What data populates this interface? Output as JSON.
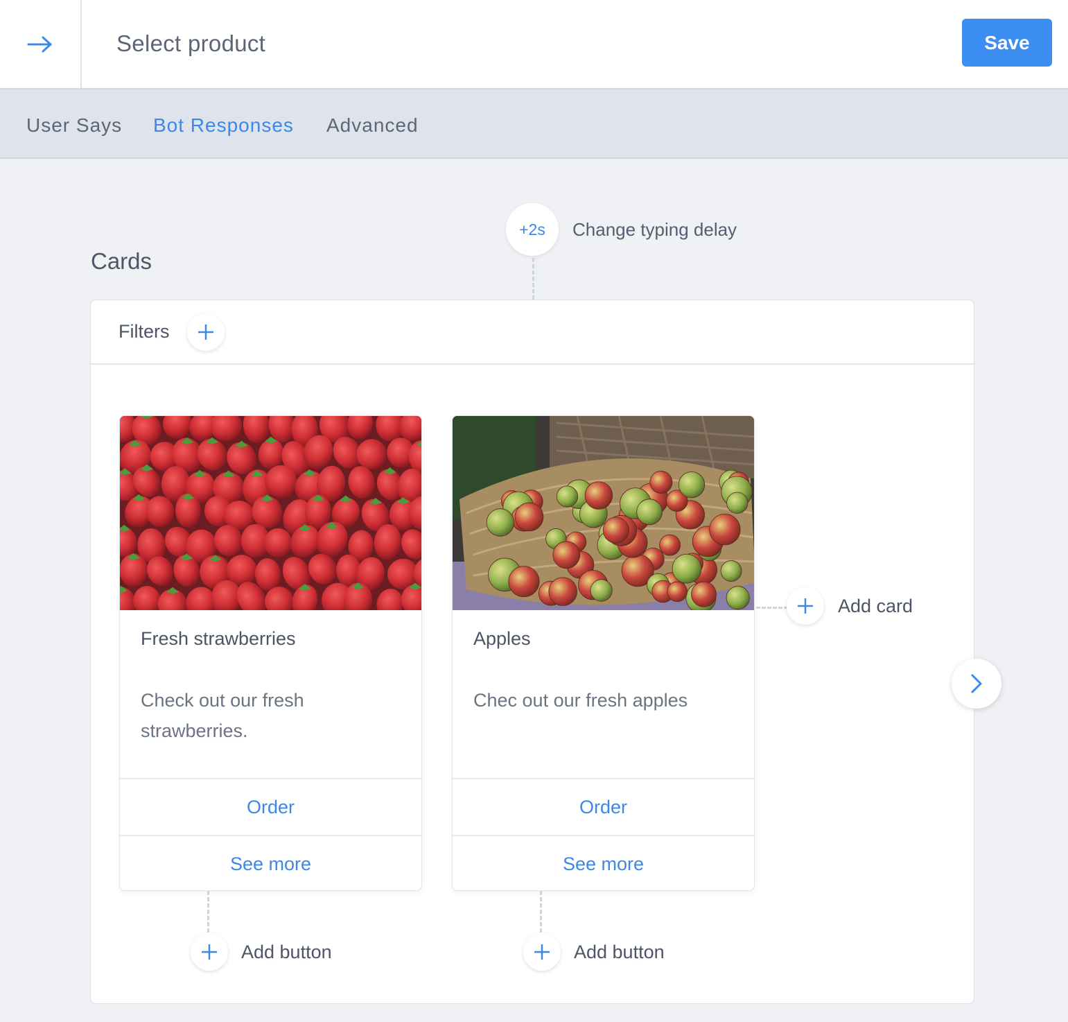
{
  "header": {
    "title": "Select product",
    "save_label": "Save",
    "back_icon": "arrow-right-icon"
  },
  "tabs": [
    {
      "label": "User Says",
      "active": false
    },
    {
      "label": "Bot Responses",
      "active": true
    },
    {
      "label": "Advanced",
      "active": false
    }
  ],
  "delay": {
    "value": "+2s",
    "label": "Change typing delay"
  },
  "section": {
    "heading": "Cards",
    "filters_label": "Filters"
  },
  "cards": [
    {
      "title": "Fresh strawberries",
      "description": "Check out our fresh strawberries.",
      "image": "strawberries-photo",
      "buttons": [
        "Order",
        "See more"
      ],
      "add_button_label": "Add button"
    },
    {
      "title": "Apples",
      "description": "Chec out our fresh apples",
      "image": "apples-basket-photo",
      "buttons": [
        "Order",
        "See more"
      ],
      "add_button_label": "Add button"
    }
  ],
  "add_card_label": "Add card",
  "colors": {
    "accent": "#3d8ef2",
    "background": "#eff1f5",
    "tabbar": "#dfe3eb"
  }
}
